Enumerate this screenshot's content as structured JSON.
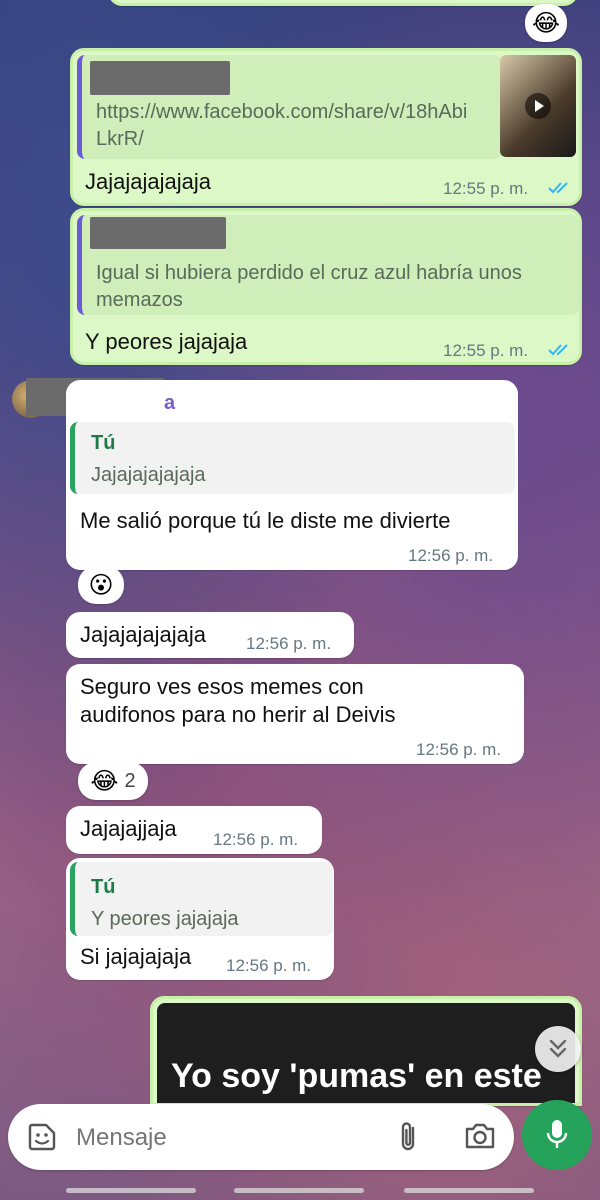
{
  "messages": {
    "m1": {
      "reaction": "😂"
    },
    "m2": {
      "quote_link": "https://www.facebook.com/share/v/18hAbiLkrR/",
      "text": "Jajajajajajaja",
      "time": "12:55 p. m."
    },
    "m3": {
      "quote_text": "Igual si hubiera perdido el cruz azul habría unos memazos",
      "text": "Y peores jajajaja",
      "time": "12:55 p. m."
    },
    "m4": {
      "sender_suffix": "a",
      "quote_author": "Tú",
      "quote_text": "Jajajajajajaja",
      "text": "Me salió porque tú le diste me divierte",
      "time": "12:56 p. m.",
      "reaction": "😮"
    },
    "m5": {
      "text": "Jajajajajajaja",
      "time": "12:56 p. m."
    },
    "m6": {
      "text_line1": "Seguro ves esos memes con",
      "text_line2": "audifonos para no herir al Deivis",
      "time": "12:56 p. m.",
      "reaction": "😂",
      "reaction_count": "2"
    },
    "m7": {
      "text": "Jajajajjaja",
      "time": "12:56 p. m."
    },
    "m8": {
      "quote_author": "Tú",
      "quote_text": "Y peores jajajaja",
      "text": "Si jajajajaja",
      "time": "12:56 p. m."
    },
    "m9": {
      "image_caption": "Yo soy 'pumas' en este"
    }
  },
  "composer": {
    "placeholder": "Mensaje"
  },
  "colors": {
    "outgoing_bubble": "#dcf8c6",
    "incoming_bubble": "#ffffff",
    "mic_button": "#25a35a",
    "read_ticks": "#34b7f1"
  }
}
